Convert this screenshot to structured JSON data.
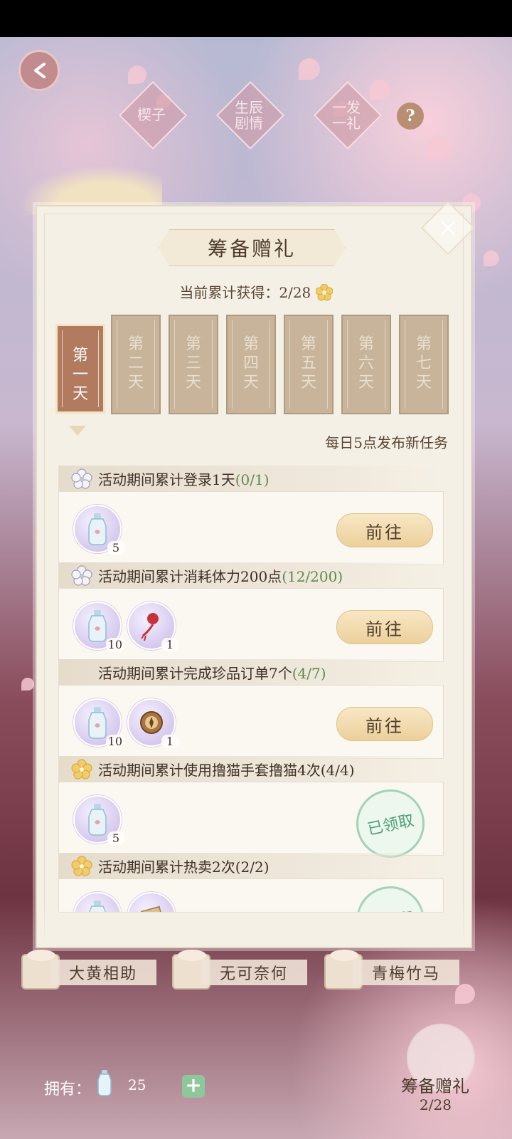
{
  "top_nav": {
    "items": [
      {
        "label": "楔子"
      },
      {
        "label": "生辰\n剧情"
      },
      {
        "label": "一发\n一礼"
      }
    ],
    "help_label": "?"
  },
  "panel": {
    "title": "筹备赠礼",
    "progress_label": "当前累计获得：",
    "progress_value": "2/28",
    "notice": "每日5点发布新任务",
    "days": [
      {
        "label": "第\n一\n天",
        "active": true
      },
      {
        "label": "第\n二\n天"
      },
      {
        "label": "第\n三\n天"
      },
      {
        "label": "第\n四\n天"
      },
      {
        "label": "第\n五\n天"
      },
      {
        "label": "第\n六\n天"
      },
      {
        "label": "第\n七\n天"
      }
    ],
    "tasks": [
      {
        "title": "活动期间累计登录1天",
        "count": "(0/1)",
        "icon": "white-flower-icon",
        "rewards": [
          {
            "icon": "bottle-icon",
            "qty": "5"
          }
        ],
        "action": "前往"
      },
      {
        "title": "活动期间累计消耗体力200点",
        "count": "(12/200)",
        "icon": "white-flower-icon",
        "rewards": [
          {
            "icon": "bottle-icon",
            "qty": "10"
          },
          {
            "icon": "red-ornament-icon",
            "qty": "1"
          }
        ],
        "action": "前往"
      },
      {
        "title": "活动期间累计完成珍品订单7个",
        "count": "(4/7)",
        "icon": "",
        "rewards": [
          {
            "icon": "bottle-icon",
            "qty": "10"
          },
          {
            "icon": "compass-icon",
            "qty": "1"
          }
        ],
        "action": "前往"
      },
      {
        "title": "活动期间累计使用撸猫手套撸猫4次",
        "count": "(4/4)",
        "icon": "gold-flower-icon",
        "rewards": [
          {
            "icon": "bottle-icon",
            "qty": "5"
          }
        ],
        "action": "已领取"
      },
      {
        "title": "活动期间累计热卖2次",
        "count": "(2/2)",
        "icon": "gold-flower-icon",
        "rewards": [
          {
            "icon": "bottle-icon",
            "qty": ""
          },
          {
            "icon": "scroll-icon",
            "qty": ""
          }
        ],
        "action": "已领取"
      }
    ]
  },
  "gift_buttons": [
    {
      "label": "大黄相助"
    },
    {
      "label": "无可奈何"
    },
    {
      "label": "青梅竹马"
    }
  ],
  "footer": {
    "owned_label": "拥有：",
    "owned_count": "25",
    "plus_label": "+",
    "entry_label": "筹备赠礼",
    "entry_count": "2/28"
  },
  "colors": {
    "panel_bg": "#f5f0e5",
    "go_button": "#ecd09b",
    "claimed": "#4ea07a",
    "count_green": "#5e8a4e"
  }
}
